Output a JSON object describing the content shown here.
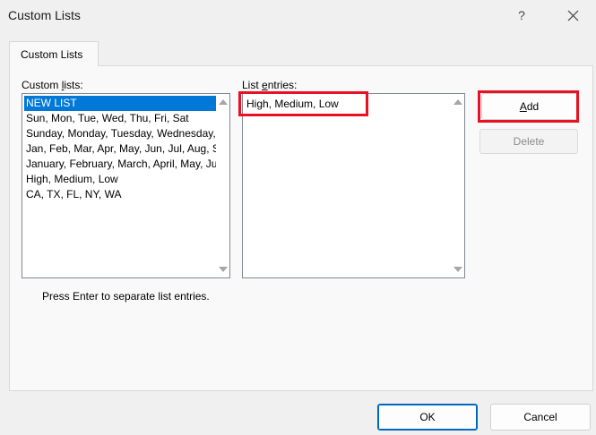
{
  "window": {
    "title": "Custom Lists",
    "help_label": "?",
    "close_icon": "close-icon"
  },
  "tab": {
    "label": "Custom Lists"
  },
  "custom_lists": {
    "label_pre": "Custom ",
    "label_accel": "l",
    "label_post": "ists:",
    "items": [
      "NEW LIST",
      "Sun, Mon, Tue, Wed, Thu, Fri, Sat",
      "Sunday, Monday, Tuesday, Wednesday, Thursday, Friday, Saturday",
      "Jan, Feb, Mar, Apr, May, Jun, Jul, Aug, Sep, Oct, Nov, Dec",
      "January, February, March, April, May, June, July, August, September, October, November, December",
      "High, Medium, Low",
      "CA, TX, FL, NY, WA"
    ],
    "selected_index": 0
  },
  "list_entries": {
    "label_pre": "List ",
    "label_accel": "e",
    "label_post": "ntries:",
    "value": "High, Medium, Low"
  },
  "buttons": {
    "add_accel": "A",
    "add_rest": "dd",
    "delete": "Delete",
    "ok": "OK",
    "cancel": "Cancel"
  },
  "hint": "Press Enter to separate list entries.",
  "colors": {
    "highlight": "#e81123",
    "selection": "#0078d7"
  }
}
